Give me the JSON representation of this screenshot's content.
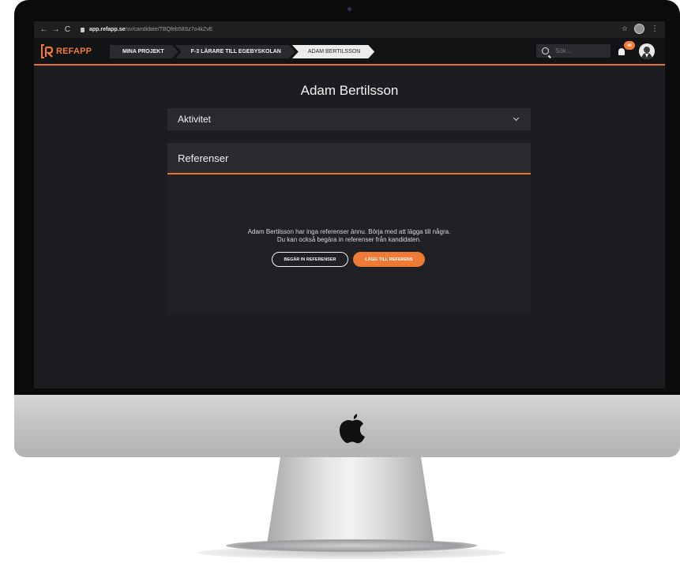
{
  "browser": {
    "nav": {
      "back": "←",
      "forward": "→",
      "reload": "C"
    },
    "address": {
      "host": "app.refapp.se",
      "path": "/sv/candidate/TBQfeb58Sz7o4kZvE"
    },
    "bookmark_icon": "star-icon"
  },
  "app": {
    "logo_text": "REFAPP",
    "accent_color": "#e8722f",
    "breadcrumbs": [
      {
        "label": "MINA PROJEKT"
      },
      {
        "label": "F-3 LÄRARE TILL EGEBYSKOLAN"
      },
      {
        "label": "ADAM BERTILSSON"
      }
    ],
    "search": {
      "placeholder": "Sök..."
    },
    "notifications": {
      "count": "40"
    }
  },
  "candidate": {
    "name": "Adam Bertilsson",
    "activity_label": "Aktivitet",
    "references_label": "Referenser",
    "empty_line1": "Adam Bertilsson har inga referenser ännu. Börja med att lägga till några.",
    "empty_line2": "Du kan också begära in referenser från kandidaten.",
    "request_button": "BEGÄR IN REFERENSER",
    "add_button": "LÄGG TILL REFERENS"
  }
}
